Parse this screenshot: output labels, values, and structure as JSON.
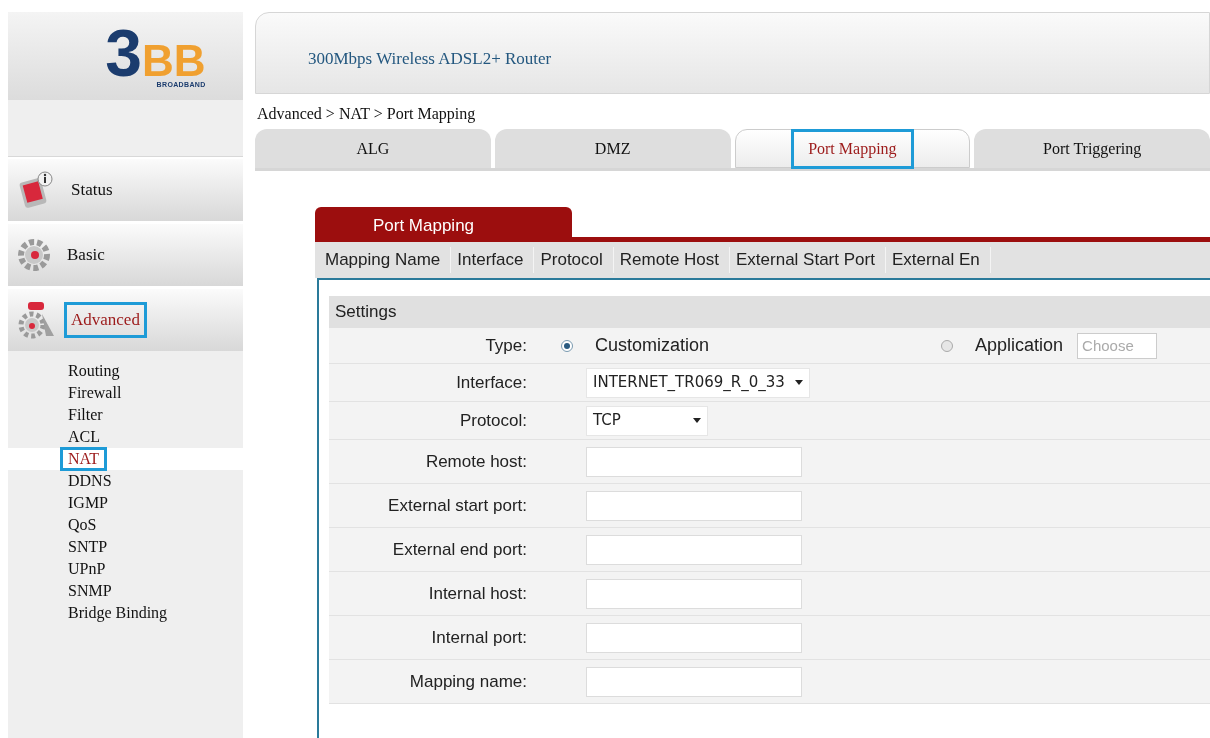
{
  "logo": {
    "mark": "3",
    "letters": "BB",
    "tagline": "BROADBAND"
  },
  "sidebar": {
    "items": [
      {
        "label": "Status",
        "selected": false
      },
      {
        "label": "Basic",
        "selected": false
      },
      {
        "label": "Advanced",
        "selected": true
      }
    ],
    "subitems": [
      {
        "label": "Routing",
        "selected": false
      },
      {
        "label": "Firewall",
        "selected": false
      },
      {
        "label": "Filter",
        "selected": false
      },
      {
        "label": "ACL",
        "selected": false
      },
      {
        "label": "NAT",
        "selected": true
      },
      {
        "label": "DDNS",
        "selected": false
      },
      {
        "label": "IGMP",
        "selected": false
      },
      {
        "label": "QoS",
        "selected": false
      },
      {
        "label": "SNTP",
        "selected": false
      },
      {
        "label": "UPnP",
        "selected": false
      },
      {
        "label": "SNMP",
        "selected": false
      },
      {
        "label": "Bridge Binding",
        "selected": false
      }
    ]
  },
  "header": {
    "title": "300Mbps Wireless ADSL2+ Router"
  },
  "breadcrumb": "Advanced > NAT > Port Mapping",
  "tabs": [
    {
      "label": "ALG",
      "selected": false
    },
    {
      "label": "DMZ",
      "selected": false
    },
    {
      "label": "Port Mapping",
      "selected": true
    },
    {
      "label": "Port Triggering",
      "selected": false
    }
  ],
  "panel": {
    "title": "Port Mapping",
    "columns": [
      "Mapping Name",
      "Interface",
      "Protocol",
      "Remote Host",
      "External Start Port",
      "External En"
    ],
    "settings_title": "Settings",
    "type": {
      "label": "Type:",
      "options": [
        {
          "label": "Customization",
          "selected": true
        },
        {
          "label": "Application",
          "selected": false
        }
      ],
      "choose_placeholder": "Choose"
    },
    "fields": [
      {
        "kind": "select",
        "label": "Interface:",
        "value": "INTERNET_TR069_R_0_33"
      },
      {
        "kind": "select",
        "label": "Protocol:",
        "value": "TCP"
      },
      {
        "kind": "text",
        "label": "Remote host:"
      },
      {
        "kind": "text",
        "label": "External start port:"
      },
      {
        "kind": "text",
        "label": "External end port:"
      },
      {
        "kind": "text",
        "label": "Internal host:"
      },
      {
        "kind": "text",
        "label": "Internal port:"
      },
      {
        "kind": "text",
        "label": "Mapping name:"
      }
    ]
  }
}
